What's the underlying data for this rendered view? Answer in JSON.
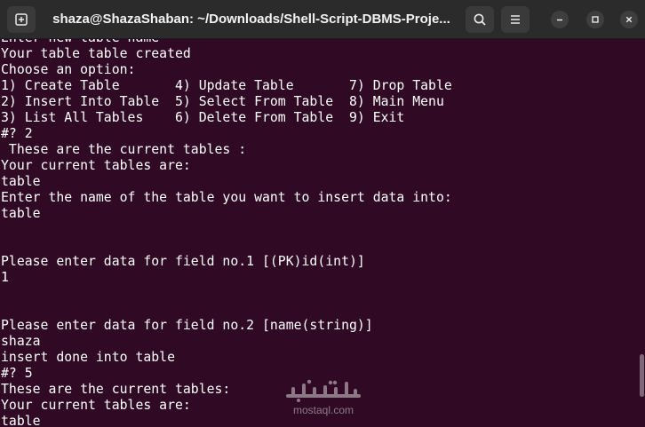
{
  "window": {
    "title": "shaza@ShazaShaban: ~/Downloads/Shell-Script-DBMS-Proje..."
  },
  "icons": {
    "new_tab": "new-tab-icon",
    "search": "search-icon",
    "menu": "hamburger-menu-icon",
    "minimize": "minimize-icon",
    "maximize": "maximize-icon",
    "close": "close-icon"
  },
  "terminal": {
    "lines": [
      "Enter new table name",
      "Your table table created",
      "Choose an option:",
      "1) Create Table       4) Update Table       7) Drop Table",
      "2) Insert Into Table  5) Select From Table  8) Main Menu",
      "3) List All Tables    6) Delete From Table  9) Exit",
      "#? 2",
      " These are the current tables :",
      "Your current tables are:",
      "table",
      "Enter the name of the table you want to insert data into:",
      "table",
      "",
      "",
      "Please enter data for field no.1 [(PK)id(int)]",
      "1",
      "",
      "",
      "Please enter data for field no.2 [name(string)]",
      "shaza",
      "insert done into table",
      "#? 5",
      "These are the current tables:",
      "Your current tables are:",
      "table"
    ]
  },
  "watermark": {
    "arabic": "مستقل",
    "latin": "mostaql.com"
  },
  "colors": {
    "terminal_bg": "#300a24",
    "titlebar_bg": "#2b2b2b",
    "text": "#ffffff"
  }
}
